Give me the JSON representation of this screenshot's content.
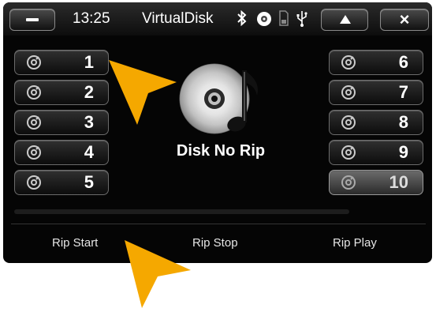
{
  "topbar": {
    "time": "13:25",
    "title": "VirtualDisk",
    "close_label": "×"
  },
  "left_discs": [
    {
      "label": "1"
    },
    {
      "label": "2"
    },
    {
      "label": "3"
    },
    {
      "label": "4"
    },
    {
      "label": "5"
    }
  ],
  "right_discs": [
    {
      "label": "6"
    },
    {
      "label": "7"
    },
    {
      "label": "8"
    },
    {
      "label": "9"
    },
    {
      "label": "10"
    }
  ],
  "selected_disc": "10",
  "main": {
    "status": "Disk No Rip"
  },
  "bottom": {
    "rip_start": "Rip Start",
    "rip_stop": "Rip Stop",
    "rip_play": "Rip Play"
  },
  "icons": {
    "bluetooth": "bluetooth-icon",
    "disc": "disc-icon",
    "sd_card": "sd-card-icon",
    "usb": "usb-icon"
  },
  "colors": {
    "accent_arrow": "#f5a800",
    "screen_bg": "#050505",
    "text": "#ffffff"
  }
}
